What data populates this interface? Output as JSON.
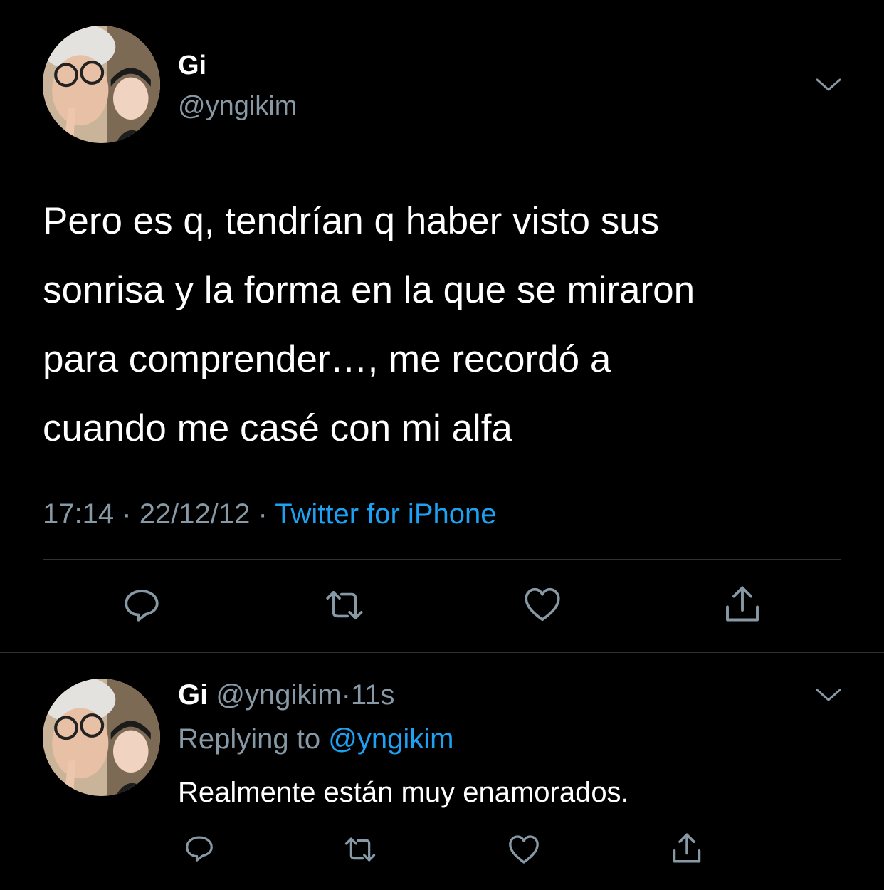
{
  "tweet": {
    "author_name": "Gi",
    "author_handle": "@yngikim",
    "text_lines": [
      "Pero es q, tendrían q haber visto sus",
      "sonrisa y la forma en la que se miraron",
      "para comprender…, me recordó a",
      "cuando me casé con mi alfa"
    ],
    "time": "17:14",
    "sep1": "·",
    "date": "22/12/12",
    "sep2": "·",
    "source": "Twitter for iPhone",
    "icons": [
      "reply-icon",
      "retweet-icon",
      "like-icon",
      "share-icon"
    ]
  },
  "reply": {
    "author_name": "Gi",
    "author_handle": "@yngikim",
    "dot": "·",
    "age": "11s",
    "replying_prefix": "Replying to",
    "replying_handle": "@yngikim",
    "text": "Realmente están muy enamorados.",
    "icons": [
      "reply-icon",
      "retweet-icon",
      "like-icon",
      "share-icon"
    ]
  },
  "colors": {
    "background": "#000000",
    "text": "#ffffff",
    "muted": "#8899a6",
    "link": "#1da1f2",
    "divider": "#2f3336"
  }
}
